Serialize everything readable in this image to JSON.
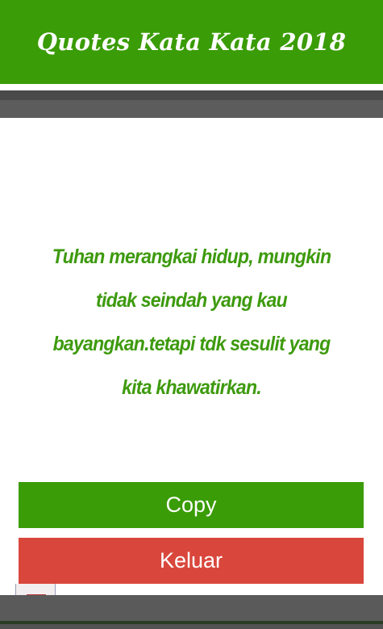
{
  "app": {
    "title": "Quotes Kata Kata 2018"
  },
  "quote": {
    "text": "Tuhan merangkai hidup, mungkin tidak seindah yang kau bayangkan.tetapi tdk sesulit yang kita khawatirkan."
  },
  "buttons": {
    "copy_label": "Copy",
    "exit_label": "Keluar"
  },
  "colors": {
    "accent_green": "#3a9c06",
    "quote_green": "#3d9a0d",
    "exit_red": "#d9473c",
    "bar_gray": "#5c5c5c"
  }
}
